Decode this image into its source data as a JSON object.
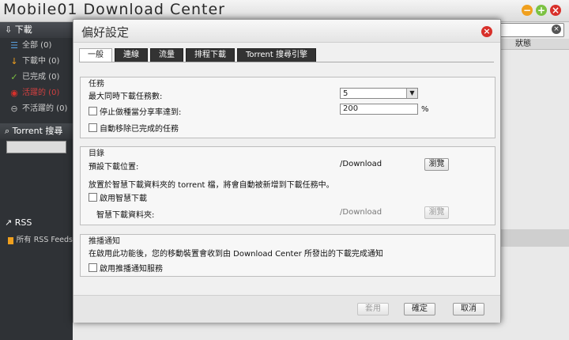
{
  "app": {
    "title": "Mobile01 Download Center"
  },
  "colors": {
    "green": "#7cc242",
    "orange": "#f0a01e",
    "red": "#d8302a"
  },
  "sidebar": {
    "header": "下載",
    "items": [
      {
        "label": "全部 (0)",
        "icon": "list-icon",
        "color": "#5aa0e0"
      },
      {
        "label": "下載中 (0)",
        "icon": "arrow-down-icon",
        "color": "#f0a01e"
      },
      {
        "label": "已完成 (0)",
        "icon": "check-icon",
        "color": "#7cc242"
      },
      {
        "label": "活躍的 (0)",
        "icon": "active-icon",
        "color": "#d8302a"
      },
      {
        "label": "不活躍的 (0)",
        "icon": "inactive-icon",
        "color": "#bbbbbb"
      }
    ],
    "torrent_search": "Torrent 搜尋",
    "rss_header": "RSS",
    "rss_item": "所有 RSS Feeds"
  },
  "main": {
    "status_col": "狀態"
  },
  "dialog": {
    "title": "偏好設定",
    "tabs": [
      "一般",
      "連線",
      "流量",
      "排程下載",
      "Torrent 搜尋引擎"
    ],
    "tasks": {
      "title": "任務",
      "max_downloads_label": "最大同時下載任務數:",
      "max_downloads_value": "5",
      "stop_seeding_label": "停止做種當分享率達到:",
      "stop_seeding_value": "200",
      "percent": "%",
      "auto_remove_label": "自動移除已完成的任務"
    },
    "folder": {
      "title": "目錄",
      "default_location_label": "預設下載位置:",
      "default_location_value": "/Download",
      "browse": "瀏覽",
      "smart_desc": "放置於智慧下載資料夾的 torrent 檔，將會自動被新增到下載任務中。",
      "enable_smart_label": "啟用智慧下載",
      "smart_folder_label": "智慧下載資料夾:",
      "smart_folder_value": "/Download",
      "browse2": "瀏覽"
    },
    "push": {
      "title": "推播通知",
      "desc": "在啟用此功能後，您的移動裝置會收到由 Download Center 所發出的下載完成通知",
      "enable_label": "啟用推播通知服務"
    },
    "buttons": {
      "apply": "套用",
      "ok": "確定",
      "cancel": "取消"
    }
  }
}
